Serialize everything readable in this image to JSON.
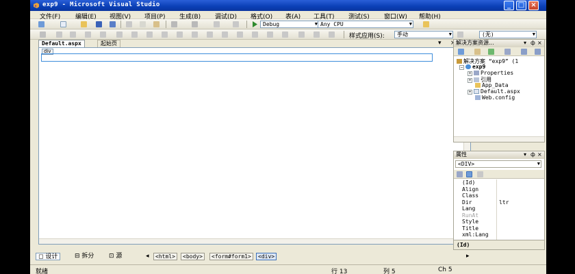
{
  "window": {
    "title": "exp9 - Microsoft Visual Studio",
    "controls": [
      "_",
      "□",
      "×"
    ]
  },
  "menu": [
    "文件(F)",
    "编辑(E)",
    "视图(V)",
    "项目(P)",
    "生成(B)",
    "调试(D)",
    "格式(O)",
    "表(A)",
    "工具(T)",
    "测试(S)",
    "窗口(W)",
    "帮助(H)"
  ],
  "toolbar": {
    "config": "Debug",
    "platform": "Any CPU",
    "style_label": "样式应用(S):",
    "style_value": "手动",
    "style_select": "(无)"
  },
  "tabs": {
    "active": "Default.aspx",
    "inactive": "起始页",
    "pin": "▾",
    "close": "×"
  },
  "editor": {
    "selected_tag": "div"
  },
  "view_bar": {
    "design": "设计",
    "split": "拆分",
    "source": "源",
    "crumbs": [
      "<html>",
      "<body>",
      "<form#form1>",
      "<div>"
    ]
  },
  "solution_explorer": {
    "title": "解决方案资源...",
    "controls": [
      "▾",
      "ф",
      "×"
    ],
    "solution": "解决方案 “exp9” (1",
    "project": "exp9",
    "items": [
      "Properties",
      "引用",
      "App_Data",
      "Default.aspx",
      "Web.config"
    ]
  },
  "properties": {
    "title": "属性",
    "controls": [
      "▾",
      "ф",
      "×"
    ],
    "object": "<DIV>",
    "rows": [
      {
        "name": "(Id)",
        "value": ""
      },
      {
        "name": "Align",
        "value": ""
      },
      {
        "name": "Class",
        "value": ""
      },
      {
        "name": "Dir",
        "value": "ltr"
      },
      {
        "name": "Lang",
        "value": ""
      },
      {
        "name": "RunAt",
        "value": ""
      },
      {
        "name": "Style",
        "value": ""
      },
      {
        "name": "Title",
        "value": ""
      },
      {
        "name": "xml:Lang",
        "value": ""
      }
    ],
    "description": "(Id)"
  },
  "status": {
    "ready": "就绪",
    "line": "行 13",
    "col": "列 5",
    "ch": "Ch 5"
  },
  "colors": {
    "titlebar": "#0A3FB5",
    "chrome": "#ECE9D8",
    "selection": "#3C8CDB"
  }
}
